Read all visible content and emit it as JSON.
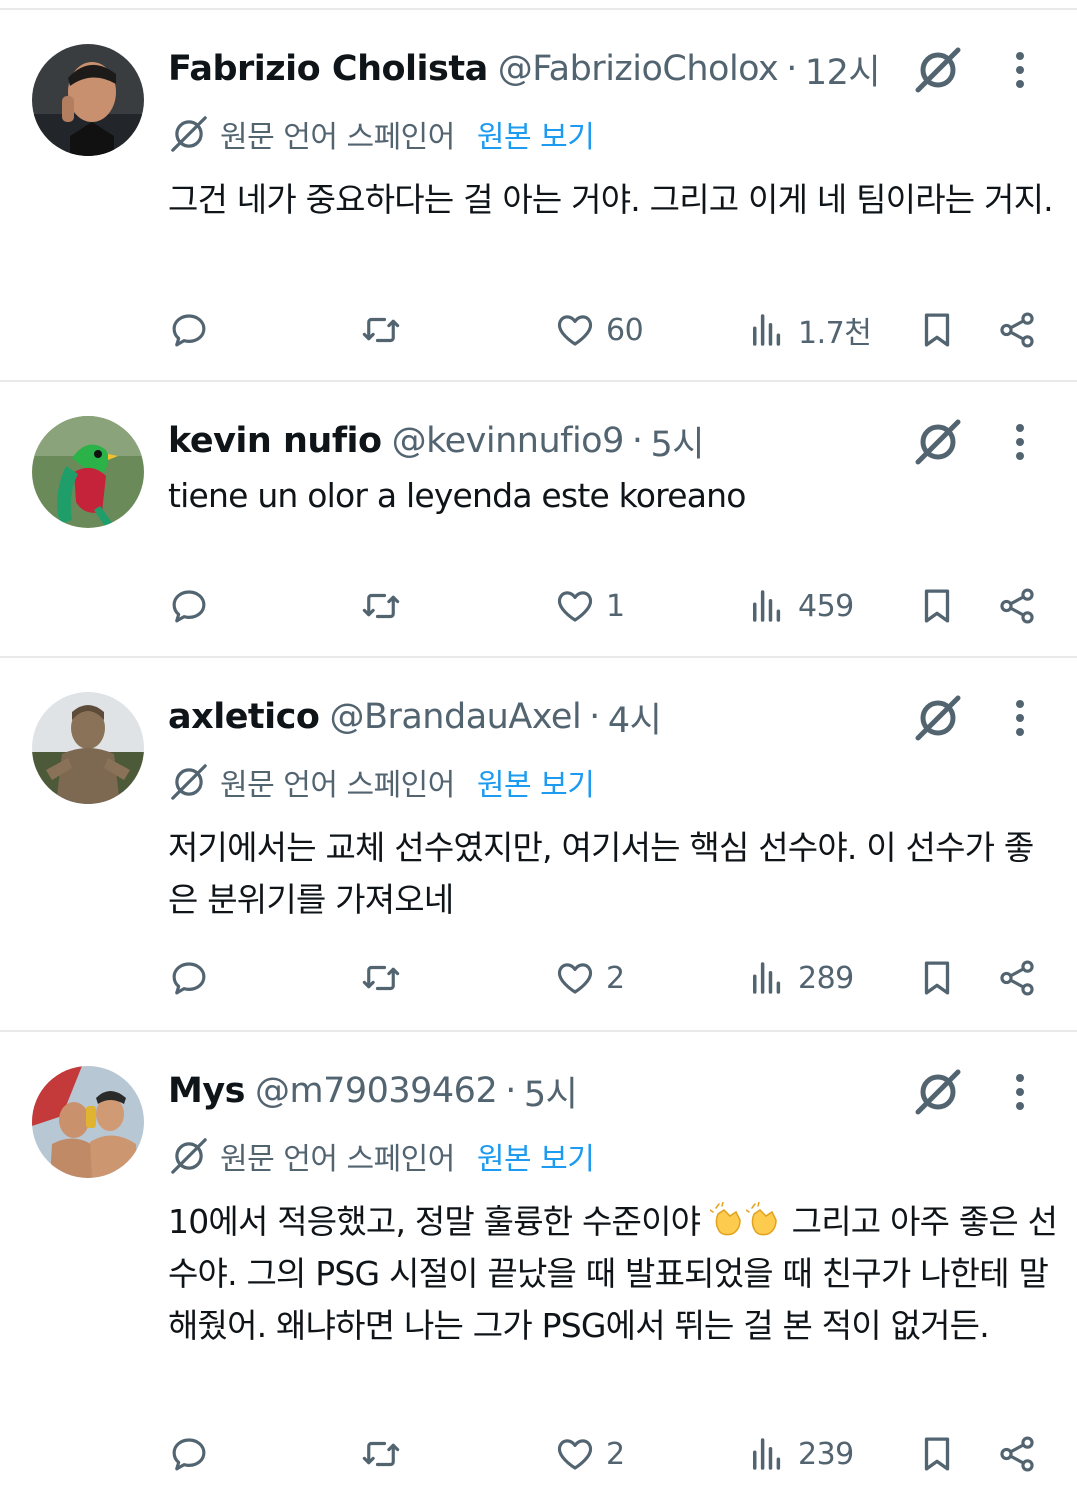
{
  "tweets": [
    {
      "name": "Fabrizio Cholista",
      "handle": "@FabrizioCholox",
      "separator": "·",
      "time": "12시",
      "translated": true,
      "translate_label": "원문 언어 스페인어",
      "translate_link": "원본 보기",
      "text": "그건 네가 중요하다는 걸 아는 거야. 그리고 이게 네 팀이라는 거지.",
      "likes": "60",
      "views": "1.7천"
    },
    {
      "name": "kevin nufio",
      "handle": "@kevinnufio9",
      "separator": "·",
      "time": "5시",
      "translated": false,
      "text": "tiene un olor a leyenda este koreano",
      "likes": "1",
      "views": "459"
    },
    {
      "name": "axletico",
      "handle": "@BrandauAxel",
      "separator": "·",
      "time": "4시",
      "translated": true,
      "translate_label": "원문 언어 스페인어",
      "translate_link": "원본 보기",
      "text": "저기에서는 교체 선수였지만, 여기서는 핵심 선수야. 이 선수가 좋은 분위기를 가져오네",
      "likes": "2",
      "views": "289"
    },
    {
      "name": "Mys",
      "handle": "@m79039462",
      "separator": "·",
      "time": "5시",
      "translated": true,
      "translate_label": "원문 언어 스페인어",
      "translate_link": "원본 보기",
      "text_before_emoji": "10에서 적응했고, 정말 훌륭한 수준이야",
      "text_after_emoji": "그리고 아주 좋은 선수야. 그의 PSG 시절이 끝났을 때 발표되었을 때 친구가 나한테 말해줬어. 왜냐하면 나는 그가 PSG에서 뛰는 걸 본 적이 없거든.",
      "emoji": "clapping-hands x2",
      "likes": "2",
      "views": "239"
    }
  ],
  "icons": [
    "reply-icon",
    "retweet-icon",
    "like-icon",
    "views-icon",
    "bookmark-icon",
    "share-icon",
    "grok-icon",
    "more-icon",
    "translate-icon"
  ],
  "colors": {
    "link": "#1d9bf0",
    "secondary": "#536471",
    "text": "#0f1419",
    "divider": "#e7e9ea"
  }
}
